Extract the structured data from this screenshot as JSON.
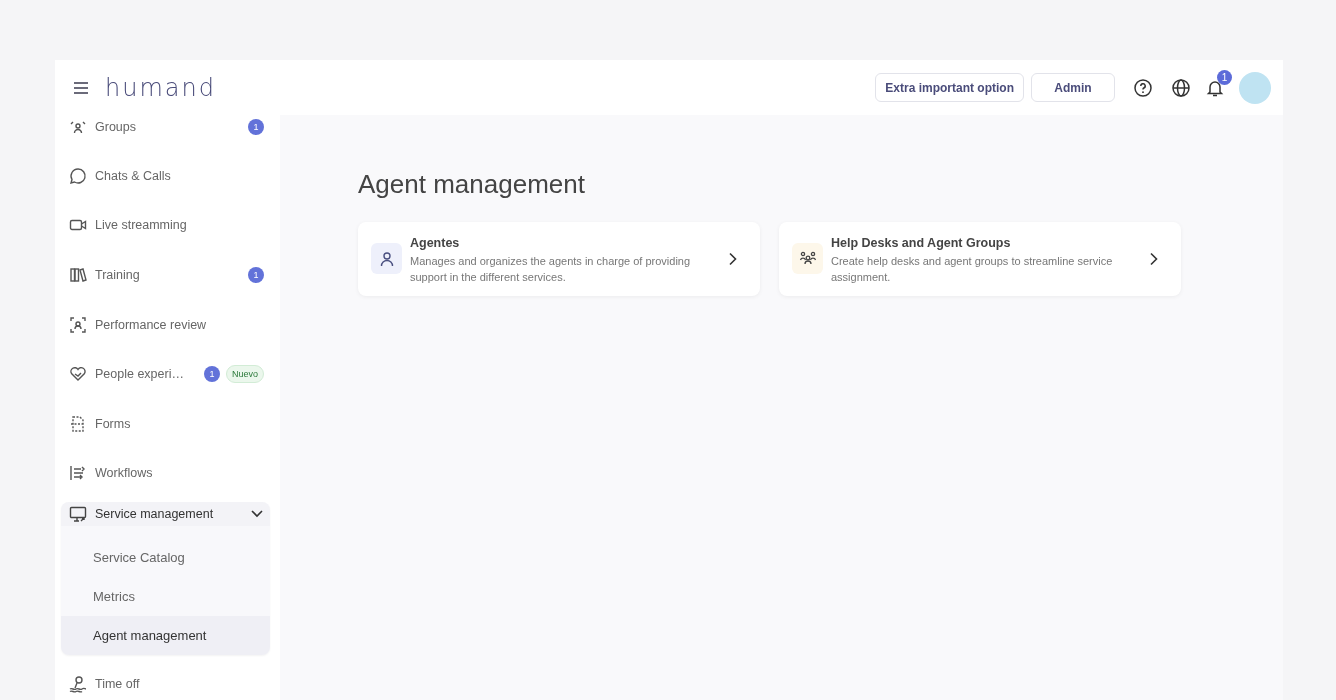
{
  "header": {
    "logo": "humand",
    "buttons": [
      "Extra important option",
      "Admin"
    ],
    "notifications_badge": "1"
  },
  "sidebar": {
    "items": [
      {
        "kind": "item",
        "label": "Groups",
        "badge": "1"
      },
      {
        "kind": "item",
        "label": "Chats & Calls"
      },
      {
        "kind": "item",
        "label": "Live streamming"
      },
      {
        "kind": "item",
        "label": "Training",
        "badge": "1"
      },
      {
        "kind": "item",
        "label": "Performance review"
      },
      {
        "kind": "item",
        "label": "People experi…",
        "badge": "1",
        "tag": "Nuevo"
      },
      {
        "kind": "item",
        "label": "Forms"
      },
      {
        "kind": "item",
        "label": "Workflows"
      },
      {
        "kind": "group",
        "label": "Service management",
        "expanded": true,
        "children": [
          {
            "label": "Service Catalog",
            "selected": false
          },
          {
            "label": "Metrics",
            "selected": false
          },
          {
            "label": "Agent management",
            "selected": true
          }
        ]
      },
      {
        "kind": "item",
        "label": "Time off"
      }
    ]
  },
  "main": {
    "title": "Agent management",
    "cards": [
      {
        "title": "Agentes",
        "description": "Manages and organizes the agents in charge of providing support in the different services."
      },
      {
        "title": "Help Desks and Agent Groups",
        "description": "Create help desks and agent groups to streamline service assignment."
      }
    ]
  }
}
